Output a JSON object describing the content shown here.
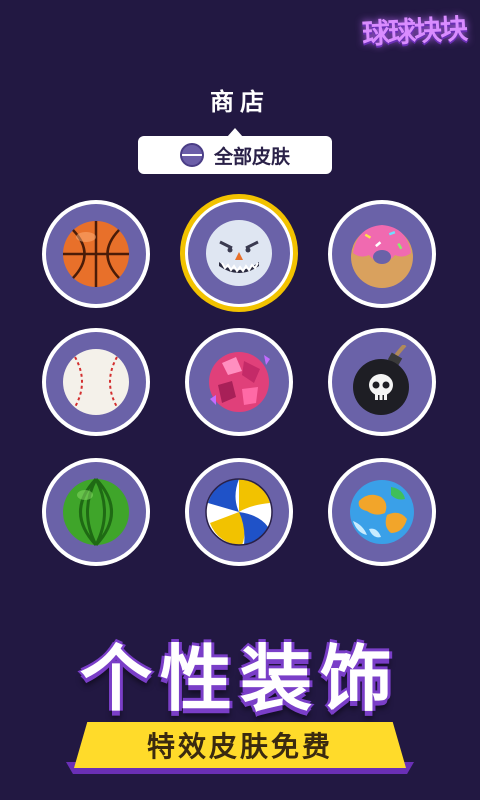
{
  "logo": {
    "text": "球球块块"
  },
  "shop": {
    "title": "商店"
  },
  "tab": {
    "label": "全部皮肤",
    "icon": "planet-icon"
  },
  "skins": [
    {
      "name": "basketball",
      "icon": "basketball-icon",
      "selected": false
    },
    {
      "name": "snowball-monster",
      "icon": "snowball-monster-icon",
      "selected": true
    },
    {
      "name": "donut",
      "icon": "donut-icon",
      "selected": false
    },
    {
      "name": "baseball",
      "icon": "baseball-icon",
      "selected": false
    },
    {
      "name": "crystal-planet",
      "icon": "crystal-planet-icon",
      "selected": false
    },
    {
      "name": "bomb",
      "icon": "bomb-icon",
      "selected": false
    },
    {
      "name": "watermelon",
      "icon": "watermelon-icon",
      "selected": false
    },
    {
      "name": "volleyball",
      "icon": "volleyball-icon",
      "selected": false
    },
    {
      "name": "earth",
      "icon": "earth-icon",
      "selected": false
    }
  ],
  "headline": {
    "text": "个性装饰"
  },
  "banner": {
    "text": "特效皮肤免费"
  },
  "colors": {
    "background": "#221842",
    "cell_ring": "#ffffff",
    "cell_fill": "#6a62a8",
    "selected_ring": "#f2c200",
    "banner": "#ffdb2a",
    "headline_outline": "#7a3ec8"
  }
}
